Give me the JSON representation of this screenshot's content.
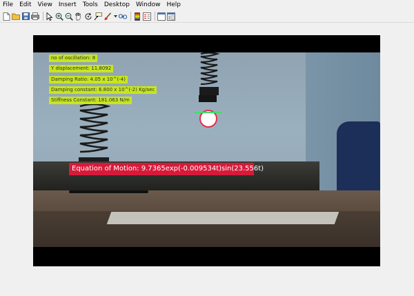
{
  "menubar": {
    "items": [
      "File",
      "Edit",
      "View",
      "Insert",
      "Tools",
      "Desktop",
      "Window",
      "Help"
    ]
  },
  "toolbar": {
    "buttons": [
      "new-figure-icon",
      "open-file-icon",
      "save-icon",
      "print-icon",
      "pointer-icon",
      "zoom-in-icon",
      "zoom-out-icon",
      "pan-icon",
      "rotate-icon",
      "data-cursor-icon",
      "brush-icon",
      "link-icon",
      "insert-colorbar-icon",
      "insert-legend-icon",
      "hide-plot-tools-icon",
      "show-plot-tools-icon"
    ]
  },
  "overlay": {
    "oscillation": "no of oscillation:  8",
    "y_displacement": "Y displacement: 11.8092",
    "damping_ratio": "Damping Ratio: 4.05 x 10^(-4)",
    "damping_constant": "Damping constant: 6.800 x 10^(-2) Kg/sec",
    "stiffness": "Stiffness Constant: 181.063 N/m",
    "equation": "Equation of Motion:  9.7365exp(-0.009534t)sin(23.556t)"
  },
  "colors": {
    "label_bg": "#c9e51f",
    "equation_bg": "#d81a3a",
    "tracker_ring": "#e0304a",
    "tracker_line": "#44dd66"
  }
}
